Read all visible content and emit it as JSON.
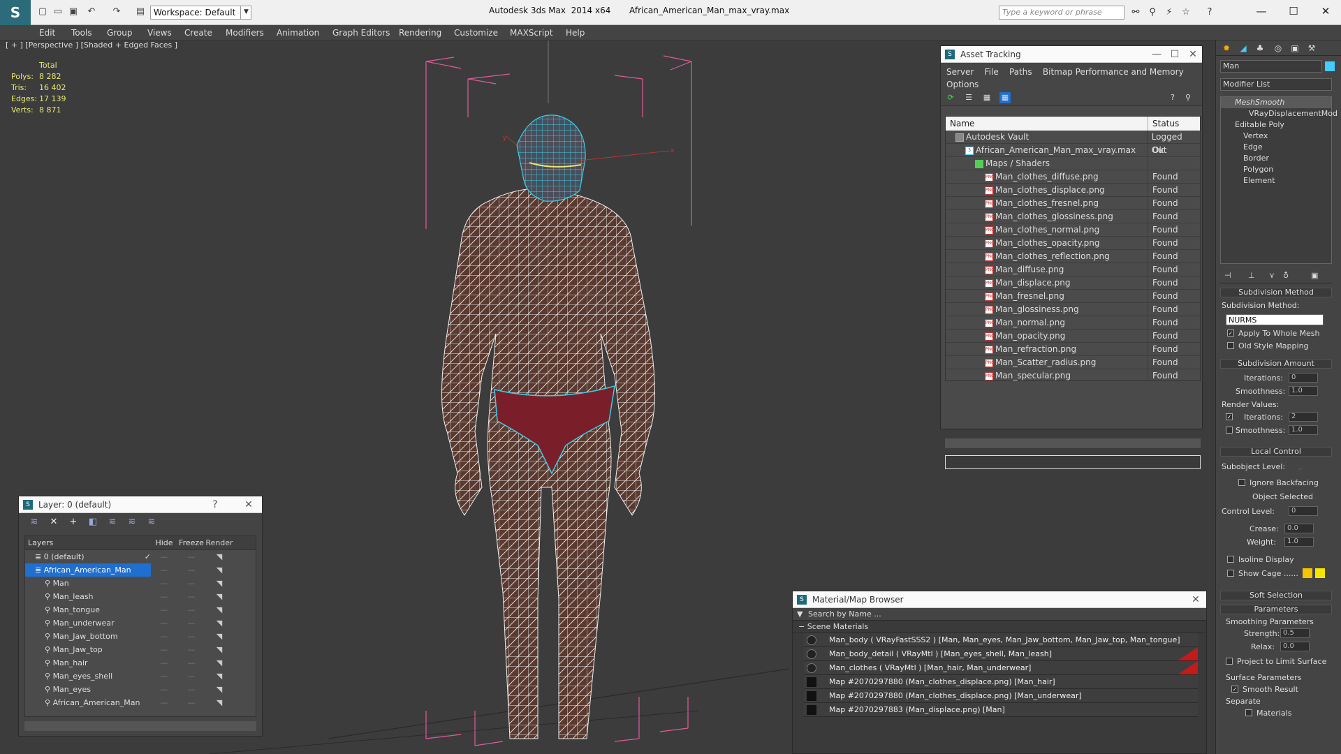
{
  "titlebar": {
    "workspace": "Workspace: Default",
    "app_title": "Autodesk 3ds Max  2014 x64       African_American_Man_max_vray.max",
    "search_placeholder": "Type a keyword or phrase"
  },
  "menubar": [
    "Edit",
    "Tools",
    "Group",
    "Views",
    "Create",
    "Modifiers",
    "Animation",
    "Graph Editors",
    "Rendering",
    "Customize",
    "MAXScript",
    "Help"
  ],
  "viewport": {
    "label": "[ + ] [Perspective ] [Shaded + Edged Faces ]",
    "stats": {
      "total_label": "Total",
      "rows": [
        {
          "k": "Polys:",
          "v": "8 282"
        },
        {
          "k": "Tris:",
          "v": "16 402"
        },
        {
          "k": "Edges:",
          "v": "17 139"
        },
        {
          "k": "Verts:",
          "v": "8 871"
        }
      ]
    }
  },
  "asset_tracking": {
    "title": "Asset Tracking",
    "menu_row1": [
      "Server",
      "File",
      "Paths",
      "Bitmap Performance and Memory"
    ],
    "menu_row2": [
      "Options"
    ],
    "columns": [
      "Name",
      "Status"
    ],
    "rows": [
      {
        "indent": 1,
        "icon": "vault",
        "name": "Autodesk Vault",
        "status": "Logged Out"
      },
      {
        "indent": 2,
        "icon": "max",
        "name": "African_American_Man_max_vray.max",
        "status": "Ok"
      },
      {
        "indent": 3,
        "icon": "folder",
        "name": "Maps / Shaders",
        "status": ""
      },
      {
        "indent": 4,
        "icon": "png",
        "name": "Man_clothes_diffuse.png",
        "status": "Found"
      },
      {
        "indent": 4,
        "icon": "png",
        "name": "Man_clothes_displace.png",
        "status": "Found"
      },
      {
        "indent": 4,
        "icon": "png",
        "name": "Man_clothes_fresnel.png",
        "status": "Found"
      },
      {
        "indent": 4,
        "icon": "png",
        "name": "Man_clothes_glossiness.png",
        "status": "Found"
      },
      {
        "indent": 4,
        "icon": "png",
        "name": "Man_clothes_normal.png",
        "status": "Found"
      },
      {
        "indent": 4,
        "icon": "png",
        "name": "Man_clothes_opacity.png",
        "status": "Found"
      },
      {
        "indent": 4,
        "icon": "png",
        "name": "Man_clothes_reflection.png",
        "status": "Found"
      },
      {
        "indent": 4,
        "icon": "png",
        "name": "Man_diffuse.png",
        "status": "Found"
      },
      {
        "indent": 4,
        "icon": "png",
        "name": "Man_displace.png",
        "status": "Found"
      },
      {
        "indent": 4,
        "icon": "png",
        "name": "Man_fresnel.png",
        "status": "Found"
      },
      {
        "indent": 4,
        "icon": "png",
        "name": "Man_glossiness.png",
        "status": "Found"
      },
      {
        "indent": 4,
        "icon": "png",
        "name": "Man_normal.png",
        "status": "Found"
      },
      {
        "indent": 4,
        "icon": "png",
        "name": "Man_opacity.png",
        "status": "Found"
      },
      {
        "indent": 4,
        "icon": "png",
        "name": "Man_refraction.png",
        "status": "Found"
      },
      {
        "indent": 4,
        "icon": "png",
        "name": "Man_Scatter_radius.png",
        "status": "Found"
      },
      {
        "indent": 4,
        "icon": "png",
        "name": "Man_specular.png",
        "status": "Found"
      }
    ]
  },
  "layer_explorer": {
    "title": "Layer: 0 (default)",
    "columns": [
      "Layers",
      "Hide",
      "Freeze",
      "Render"
    ],
    "rows": [
      {
        "indent": 1,
        "name": "0 (default)",
        "selected": false,
        "check": true
      },
      {
        "indent": 1,
        "name": "African_American_Man",
        "selected": true,
        "check": false
      },
      {
        "indent": 2,
        "name": "Man",
        "selected": false,
        "check": false
      },
      {
        "indent": 2,
        "name": "Man_leash",
        "selected": false,
        "check": false
      },
      {
        "indent": 2,
        "name": "Man_tongue",
        "selected": false,
        "check": false
      },
      {
        "indent": 2,
        "name": "Man_underwear",
        "selected": false,
        "check": false
      },
      {
        "indent": 2,
        "name": "Man_Jaw_bottom",
        "selected": false,
        "check": false
      },
      {
        "indent": 2,
        "name": "Man_Jaw_top",
        "selected": false,
        "check": false
      },
      {
        "indent": 2,
        "name": "Man_hair",
        "selected": false,
        "check": false
      },
      {
        "indent": 2,
        "name": "Man_eyes_shell",
        "selected": false,
        "check": false
      },
      {
        "indent": 2,
        "name": "Man_eyes",
        "selected": false,
        "check": false
      },
      {
        "indent": 2,
        "name": "African_American_Man",
        "selected": false,
        "check": false
      }
    ]
  },
  "material_browser": {
    "title": "Material/Map Browser",
    "search_placeholder": "Search by Name ...",
    "group": "Scene Materials",
    "rows": [
      {
        "kind": "sphere",
        "text": "Man_body  ( VRayFastSSS2 )  [Man, Man_eyes, Man_Jaw_bottom, Man_Jaw_top, Man_tongue]",
        "red": false
      },
      {
        "kind": "sphere",
        "text": "Man_body_detail  ( VRayMtl )  [Man_eyes_shell, Man_leash]",
        "red": true
      },
      {
        "kind": "sphere",
        "text": "Man_clothes  ( VRayMtl )  [Man_hair, Man_underwear]",
        "red": true
      },
      {
        "kind": "square",
        "text": "Map #2070297880 (Man_clothes_displace.png)  [Man_hair]",
        "red": false
      },
      {
        "kind": "square",
        "text": "Map #2070297880 (Man_clothes_displace.png)  [Man_underwear]",
        "red": false
      },
      {
        "kind": "square",
        "text": "Map #2070297883 (Man_displace.png)  [Man]",
        "red": false
      }
    ]
  },
  "command_panel": {
    "object_name": "Man",
    "modifier_list": "Modifier List",
    "stack": [
      "MeshSmooth",
      "VRayDisplacementMod",
      "Editable Poly",
      "Vertex",
      "Edge",
      "Border",
      "Polygon",
      "Element"
    ],
    "subdivision_method": {
      "title": "Subdivision Method",
      "label": "Subdivision Method:",
      "value": "NURMS",
      "apply_whole_mesh": "Apply To Whole Mesh",
      "old_style": "Old Style Mapping"
    },
    "subdivision_amount": {
      "title": "Subdivision Amount",
      "iterations_label": "Iterations:",
      "iterations": "0",
      "smoothness_label": "Smoothness:",
      "smoothness": "1.0",
      "render_values": "Render Values:",
      "r_iterations": "2",
      "r_smoothness": "1.0"
    },
    "local_control": {
      "title": "Local Control",
      "subobject": "Subobject Level:",
      "ignore_backfacing": "Ignore Backfacing",
      "object_selected": "Object Selected",
      "control_level_label": "Control Level:",
      "control_level": "0",
      "crease_label": "Crease:",
      "crease": "0.0",
      "weight_label": "Weight:",
      "weight": "1.0",
      "isoline": "Isoline Display",
      "show_cage": "Show Cage ......"
    },
    "soft_selection": "Soft Selection",
    "parameters": {
      "title": "Parameters",
      "smoothing": "Smoothing Parameters",
      "strength_label": "Strength:",
      "strength": "0.5",
      "relax_label": "Relax:",
      "relax": "0.0",
      "project": "Project to Limit Surface",
      "surface": "Surface Parameters",
      "smooth_result": "Smooth Result",
      "separate": "Separate",
      "materials": "Materials"
    }
  },
  "colors": {
    "accent": "#1e6fcf",
    "wire": "#ffffff",
    "skin": "#5a3a30",
    "bbox": "#e05a9a",
    "selected_wire": "#38d0e8",
    "underwear": "#7a1f2a"
  }
}
